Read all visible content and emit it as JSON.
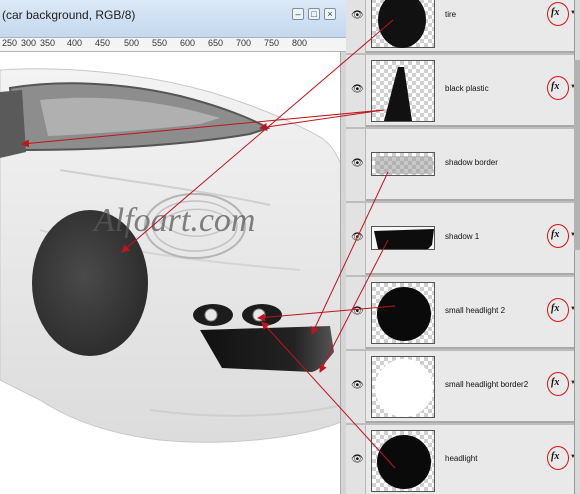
{
  "window": {
    "title": "(car background, RGB/8)",
    "minimize_glyph": "–",
    "maximize_glyph": "□",
    "close_glyph": "×"
  },
  "ruler": {
    "labels": [
      "250",
      "300",
      "350",
      "400",
      "450",
      "500",
      "550",
      "600",
      "650",
      "700",
      "750",
      "800"
    ]
  },
  "canvas": {
    "watermark": "Alfoart.com"
  },
  "layers": [
    {
      "name": "tire",
      "thumb": "tire",
      "fx": "fx"
    },
    {
      "name": "black plastic",
      "thumb": "plastic",
      "fx": "fx"
    },
    {
      "name": "shadow border",
      "thumb": "shadow-border",
      "fx": ""
    },
    {
      "name": "shadow 1",
      "thumb": "shadow1",
      "fx": "fx"
    },
    {
      "name": "small headlight 2",
      "thumb": "circle",
      "fx": "fx"
    },
    {
      "name": "small headlight border2",
      "thumb": "white-circle",
      "fx": "fx"
    },
    {
      "name": "headlight",
      "thumb": "circle",
      "fx": "fx"
    }
  ],
  "icons": {
    "eye": "eye-icon",
    "fx": "fx-icon"
  },
  "colors": {
    "arrow": "#c0141c",
    "fx_ring": "#dd1111",
    "titlebar": "#c4d8ee"
  }
}
